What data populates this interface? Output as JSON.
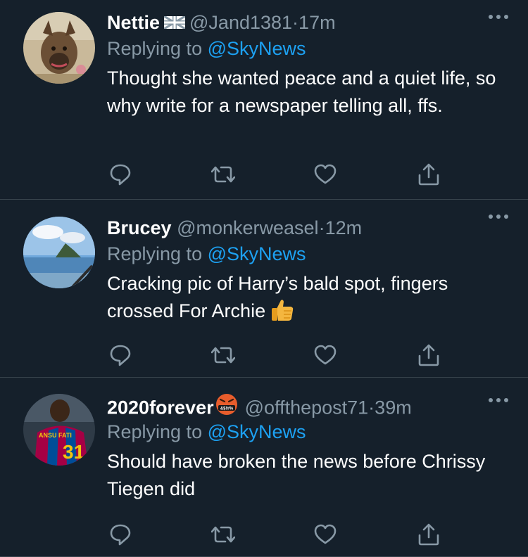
{
  "colors": {
    "background": "#15202b",
    "divider": "#38444d",
    "secondary_text": "#8899a6",
    "link": "#1da1f2"
  },
  "tweets": [
    {
      "name": "Nettie",
      "name_badge": "uk-flag-icon",
      "handle": "@Jand1381",
      "separator": "·",
      "time": "17m",
      "replying_prefix": "Replying to",
      "replying_to": "@SkyNews",
      "text": "Thought she wanted peace and a quiet life, so why write for a newspaper telling all, ffs."
    },
    {
      "name": "Brucey",
      "handle": "@monkerweasel",
      "separator": "·",
      "time": "12m",
      "replying_prefix": "Replying to",
      "replying_to": "@SkyNews",
      "text": "Cracking pic of Harry’s bald spot, fingers crossed For Archie",
      "text_emoji": "thumbs-up-icon"
    },
    {
      "name": "2020forever",
      "name_badge": "angry-face-icon",
      "handle": "@offthepost71",
      "separator": "·",
      "time": "39m",
      "replying_prefix": "Replying to",
      "replying_to": "@SkyNews",
      "text": "Should have broken the news before Chrissy Tiegen did"
    }
  ]
}
